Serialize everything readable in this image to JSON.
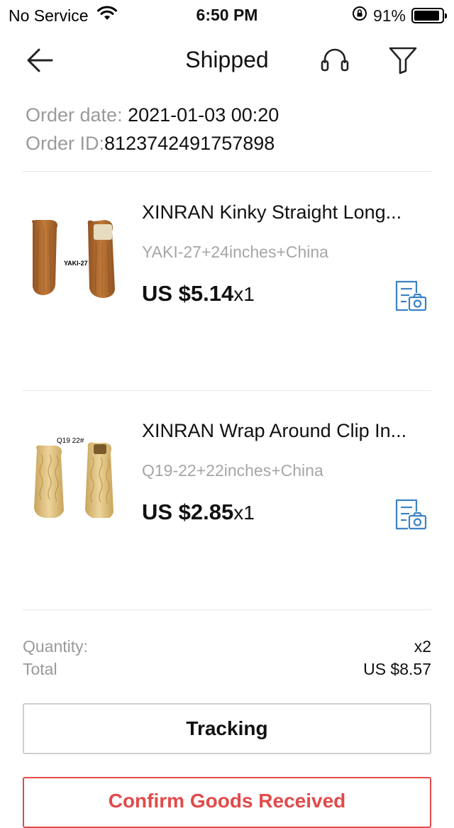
{
  "status_bar": {
    "carrier": "No Service",
    "time": "6:50 PM",
    "battery_percent": "91%",
    "battery_level": 0.91
  },
  "header": {
    "title": "Shipped",
    "icons": [
      "back-arrow-icon",
      "headset-icon",
      "filter-icon"
    ]
  },
  "order": {
    "date_label": "Order date:",
    "date_value": "2021-01-03 00:20",
    "id_label": "Order ID:",
    "id_value": "8123742491757898"
  },
  "items": [
    {
      "title": "XINRAN Kinky Straight Long...",
      "sku": "YAKI-27+24inches+China",
      "price": "US $5.14",
      "qty": "x1",
      "image_label": "YAKI-27",
      "hair_color": "#b06a2e"
    },
    {
      "title": "XINRAN Wrap Around Clip In...",
      "sku": "Q19-22+22inches+China",
      "price": "US $2.85",
      "qty": "x1",
      "image_label": "Q19 22#",
      "hair_color": "#dcc07a"
    }
  ],
  "summary": {
    "quantity_label": "Quantity:",
    "quantity_value": "x2",
    "total_label": "Total",
    "total_value": "US $8.57"
  },
  "actions": {
    "tracking_label": "Tracking",
    "confirm_label": "Confirm Goods Received"
  },
  "colors": {
    "accent_red": "#e24a4a",
    "icon_blue": "#3b82c4",
    "muted_text": "#9a9a9a"
  }
}
